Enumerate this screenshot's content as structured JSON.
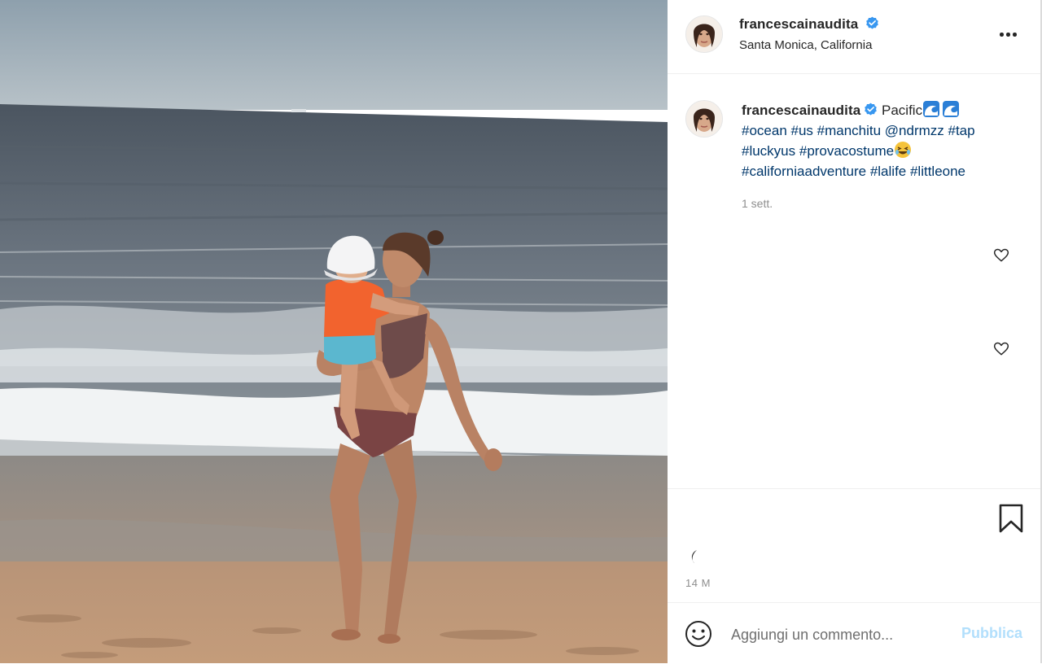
{
  "post": {
    "username": "francescainaudita",
    "location": "Santa Monica, California"
  },
  "caption": {
    "username": "francescainaudita",
    "text": "Pacific",
    "hashtags_line1": "#ocean #us #manchitu @ndrmzz #tap",
    "hashtags_line2": "#luckyus #provacostume",
    "hashtags_line3": "#californiaadventure #lalife #littleone",
    "time": "1 sett."
  },
  "footer": {
    "date": "14 M"
  },
  "comment": {
    "placeholder": "Aggiungi un commento...",
    "publish_label": "Pubblica"
  },
  "icons": {
    "more": "more-options-icon",
    "verified": "verified-badge-icon",
    "like": "heart-icon",
    "save": "bookmark-icon",
    "emoji": "smiley-icon"
  },
  "colors": {
    "verified": "#3897f0",
    "hashtag": "#00376b",
    "publish_disabled": "#b2dffc",
    "muted": "#8e8e8e"
  }
}
